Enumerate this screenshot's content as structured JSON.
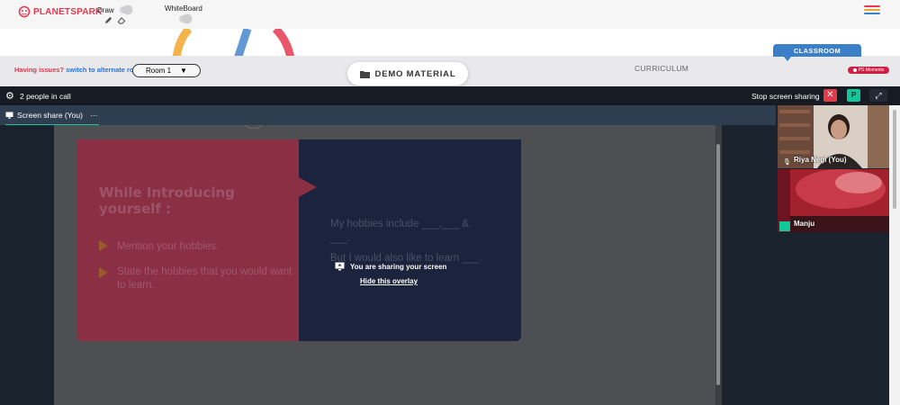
{
  "app": {
    "logo_text": "PLANETSPARK"
  },
  "toolbar": {
    "draw_label": "Draw",
    "whiteboard_label": "WhiteBoard",
    "icons": [
      "pencil-icon",
      "eraser-icon",
      "hamburger-menu-icon"
    ],
    "menu_colors": [
      "#e63950",
      "#f2a72c",
      "#3b7fc9"
    ]
  },
  "classroom_bar": {
    "issues_text": "Having issues?",
    "switch_link": "switch to alternate room",
    "room_select": "Room 1",
    "demo_material": "DEMO MATERIAL",
    "curriculum_tab": "CURRICULUM",
    "classroom_tab": "CLASSROOM",
    "ps_moments": "PS Moments"
  },
  "call": {
    "people_count": "2 people in call",
    "stop_sharing": "Stop screen sharing",
    "stop_button": "✕",
    "participant_button": "P",
    "tab_label": "Screen share (You)",
    "tab_menu": "···"
  },
  "slide": {
    "heading": "While Introducing yourself :",
    "bullets": [
      "Mention your hobbies.",
      "State the hobbies that you would want to learn."
    ],
    "right_text_1": "My hobbies include ___,___ & ___.",
    "right_text_2": "But I would also like to learn ___."
  },
  "overlay": {
    "sharing_text": "You are sharing your screen",
    "hide_link": "Hide this overlay"
  },
  "participants": [
    {
      "name": "Riya Negi (You)"
    },
    {
      "name": "Manju"
    }
  ],
  "colors": {
    "accent_red": "#e23b4a",
    "accent_green": "#12c79a",
    "classroom_blue": "#3b7fc9",
    "call_bar": "#161b24"
  }
}
